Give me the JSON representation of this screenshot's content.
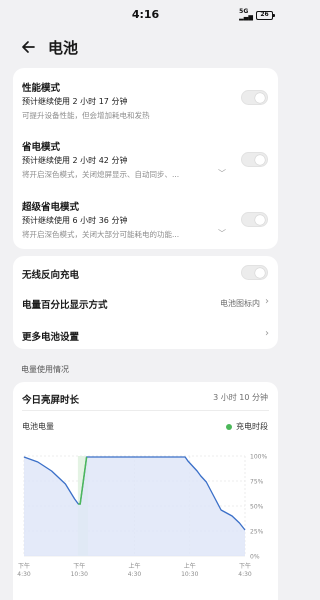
{
  "status_bar": {
    "time": "4:16",
    "signal": "5G",
    "battery": "26"
  },
  "header": {
    "title": "电池",
    "back_icon": "back-arrow-icon"
  },
  "power_modes": [
    {
      "title": "性能模式",
      "estimate": "预计继续使用 2 小时 17 分钟",
      "description": "可提升设备性能，但会增加耗电和发热",
      "enabled": false,
      "expandable": false
    },
    {
      "title": "省电模式",
      "estimate": "预计继续使用 2 小时 42 分钟",
      "description": "将开启深色模式，关闭熄屏显示、自动同步、...",
      "enabled": false,
      "expandable": true
    },
    {
      "title": "超级省电模式",
      "estimate": "预计继续使用 6 小时 36 分钟",
      "description": "将开启深色模式，关闭大部分可能耗电的功能...",
      "enabled": false,
      "expandable": true
    }
  ],
  "settings": {
    "wireless_reverse_charge": {
      "label": "无线反向充电",
      "enabled": false
    },
    "percentage_display": {
      "label": "电量百分比显示方式",
      "value": "电池图标内"
    },
    "more_settings": {
      "label": "更多电池设置"
    }
  },
  "usage": {
    "section_label": "电量使用情况",
    "screen_on_label": "今日亮屏时长",
    "screen_on_value": "3 小时 10 分钟",
    "chart_label": "电池电量",
    "legend_label": "充电时段",
    "legend_color": "#4cb85a"
  },
  "chart_data": {
    "type": "area",
    "title": "电池电量",
    "x_tick_labels": [
      [
        "下午",
        "4:30"
      ],
      [
        "下午",
        "10:30"
      ],
      [
        "上午",
        "4:30"
      ],
      [
        "上午",
        "10:30"
      ],
      [
        "下午",
        "4:30"
      ]
    ],
    "x_hours": [
      0,
      6,
      12,
      18,
      24
    ],
    "y_tick_labels": [
      "100%",
      "75%",
      "50%",
      "25%",
      "0%"
    ],
    "ylim": [
      0,
      100
    ],
    "series": [
      {
        "name": "",
        "x": [
          0,
          1.5,
          3,
          4.5,
          5.5,
          5.9,
          6.1,
          6.4,
          6.8,
          12,
          17.5,
          17.8,
          18.3,
          18.8,
          19.2,
          19.8,
          20.6,
          21.4,
          22.0,
          22.6,
          23.4,
          24
        ],
        "y": [
          99,
          94,
          85,
          72,
          57,
          52,
          52,
          72,
          99,
          99,
          99,
          95,
          90,
          85,
          80,
          74,
          60,
          46,
          43,
          40,
          33,
          26
        ]
      }
    ],
    "charging_periods": [
      [
        5.85,
        6.95
      ]
    ],
    "fill_color": "#dfe6f8",
    "line_color": "#3a6fc8",
    "charging_color": "#4cb85a",
    "grid": true
  }
}
